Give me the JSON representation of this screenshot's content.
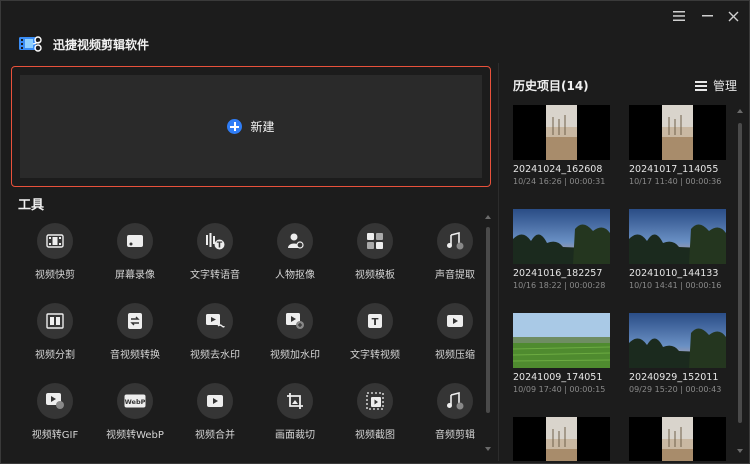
{
  "app": {
    "title": "迅捷视频剪辑软件",
    "logo_icon": "film-scissors-logo"
  },
  "window_controls": [
    "menu-icon",
    "minimize-icon",
    "close-icon"
  ],
  "new_project": {
    "label": "新建",
    "accent": "#2f7df6",
    "border_color": "#e8513b"
  },
  "tools": {
    "title": "工具",
    "items": [
      {
        "label": "视频快剪",
        "icon": "film-icon"
      },
      {
        "label": "屏幕录像",
        "icon": "screen-record-icon"
      },
      {
        "label": "文字转语音",
        "icon": "text-to-speech-icon"
      },
      {
        "label": "人物抠像",
        "icon": "person-cutout-icon"
      },
      {
        "label": "视频模板",
        "icon": "template-icon"
      },
      {
        "label": "声音提取",
        "icon": "music-extract-icon"
      },
      {
        "label": "视频分割",
        "icon": "video-split-icon"
      },
      {
        "label": "音视频转换",
        "icon": "av-convert-icon"
      },
      {
        "label": "视频去水印",
        "icon": "remove-watermark-icon"
      },
      {
        "label": "视频加水印",
        "icon": "add-watermark-icon"
      },
      {
        "label": "文字转视频",
        "icon": "text-to-video-icon"
      },
      {
        "label": "视频压缩",
        "icon": "video-compress-icon"
      },
      {
        "label": "视频转GIF",
        "icon": "video-to-gif-icon"
      },
      {
        "label": "视频转WebP",
        "icon": "video-to-webp-icon"
      },
      {
        "label": "视频合并",
        "icon": "video-merge-icon"
      },
      {
        "label": "画面裁切",
        "icon": "crop-icon"
      },
      {
        "label": "视频截图",
        "icon": "screenshot-icon"
      },
      {
        "label": "音频剪辑",
        "icon": "audio-edit-icon"
      }
    ]
  },
  "history": {
    "title": "历史项目(14)",
    "manage_label": "管理",
    "items": [
      {
        "name": "20241024_162608",
        "meta": "10/24 16:26 | 00:00:31",
        "thumb": "portrait-field"
      },
      {
        "name": "20241017_114055",
        "meta": "10/17 11:40 | 00:00:36",
        "thumb": "portrait-field"
      },
      {
        "name": "20241016_182257",
        "meta": "10/16 18:22 | 00:00:28",
        "thumb": "sunset-trees"
      },
      {
        "name": "20241010_144133",
        "meta": "10/10 14:41 | 00:00:16",
        "thumb": "sunset-trees"
      },
      {
        "name": "20241009_174051",
        "meta": "10/09 17:40 | 00:00:15",
        "thumb": "green-field"
      },
      {
        "name": "20240929_152011",
        "meta": "09/29 15:20 | 00:00:43",
        "thumb": "sunset-trees"
      },
      {
        "name": "",
        "meta": "",
        "thumb": "portrait-field"
      },
      {
        "name": "",
        "meta": "",
        "thumb": "portrait-field"
      }
    ]
  }
}
